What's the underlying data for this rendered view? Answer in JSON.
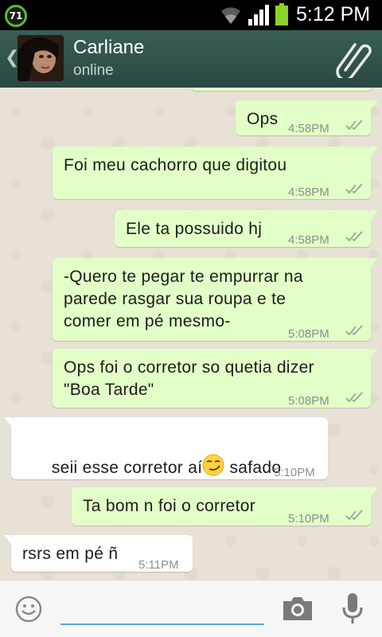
{
  "status_bar": {
    "notification_count": "71",
    "time": "5:12 PM",
    "icons": [
      "notification-icon",
      "wifi-icon",
      "signal-icon",
      "battery-icon"
    ]
  },
  "header": {
    "contact_name": "Carliane",
    "contact_status": "online",
    "icons": [
      "back-icon",
      "avatar",
      "attach-icon"
    ]
  },
  "messages": [
    {
      "direction": "out",
      "text": "Ops",
      "time": "4:58PM",
      "ticks": true
    },
    {
      "direction": "out",
      "text": "Foi meu cachorro que digitou",
      "time": "4:58PM",
      "ticks": true
    },
    {
      "direction": "out",
      "text": "Ele ta possuido hj",
      "time": "4:58PM",
      "ticks": true
    },
    {
      "direction": "out",
      "text": "-Quero te pegar te empurrar na\nparede rasgar sua roupa e te\ncomer em pé mesmo-",
      "time": "5:08PM",
      "ticks": true
    },
    {
      "direction": "out",
      "text": "Ops foi o corretor so quetia dizer\n\"Boa Tarde\"",
      "time": "5:08PM",
      "ticks": true
    },
    {
      "direction": "in",
      "text_before": "seii esse corretor aí",
      "emoji": "smirk-emoji",
      "text_after": " safado",
      "time": "5:10PM"
    },
    {
      "direction": "out",
      "text": "Ta bom n foi o corretor",
      "time": "5:10PM",
      "ticks": true
    },
    {
      "direction": "in",
      "text": "rsrs em pé ñ",
      "time": "5:11PM"
    }
  ],
  "input_bar": {
    "placeholder": "",
    "icons": [
      "emoji-icon",
      "camera-icon",
      "mic-icon"
    ]
  },
  "colors": {
    "outgoing_bubble": "#e2ffc7",
    "incoming_bubble": "#ffffff",
    "header": "#2f4f4a",
    "ticks": "#9aa39a",
    "input_underline": "#5aa6d6"
  }
}
